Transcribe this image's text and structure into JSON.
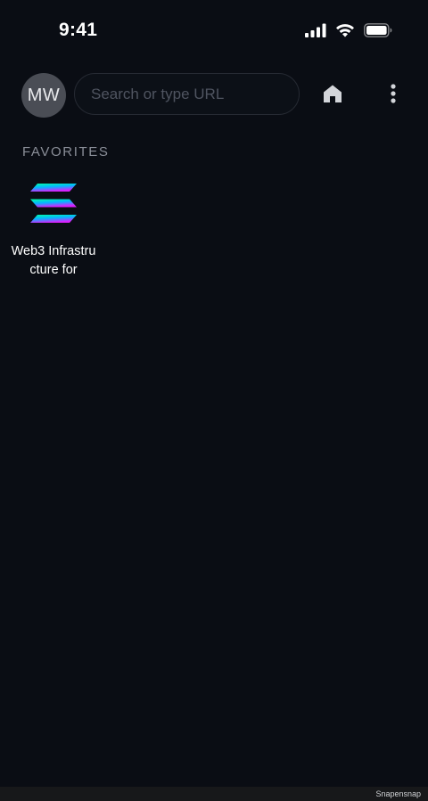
{
  "status_bar": {
    "time": "9:41"
  },
  "toolbar": {
    "avatar_initials": "MW",
    "search_placeholder": "Search or type URL",
    "search_value": ""
  },
  "favorites": {
    "label": "FAVORITES",
    "items": [
      {
        "title": "Web3 Infrastructure for",
        "icon": "solana-logo-icon",
        "colors": [
          "#00ffa3",
          "#03e1ff",
          "#dc1fff"
        ]
      }
    ]
  },
  "footer": {
    "watermark": "Snapensnap"
  },
  "colors": {
    "background": "#0a0d14",
    "search_border": "#262a33",
    "avatar_bg": "#4a4d55",
    "muted_text": "#8a8e98"
  }
}
